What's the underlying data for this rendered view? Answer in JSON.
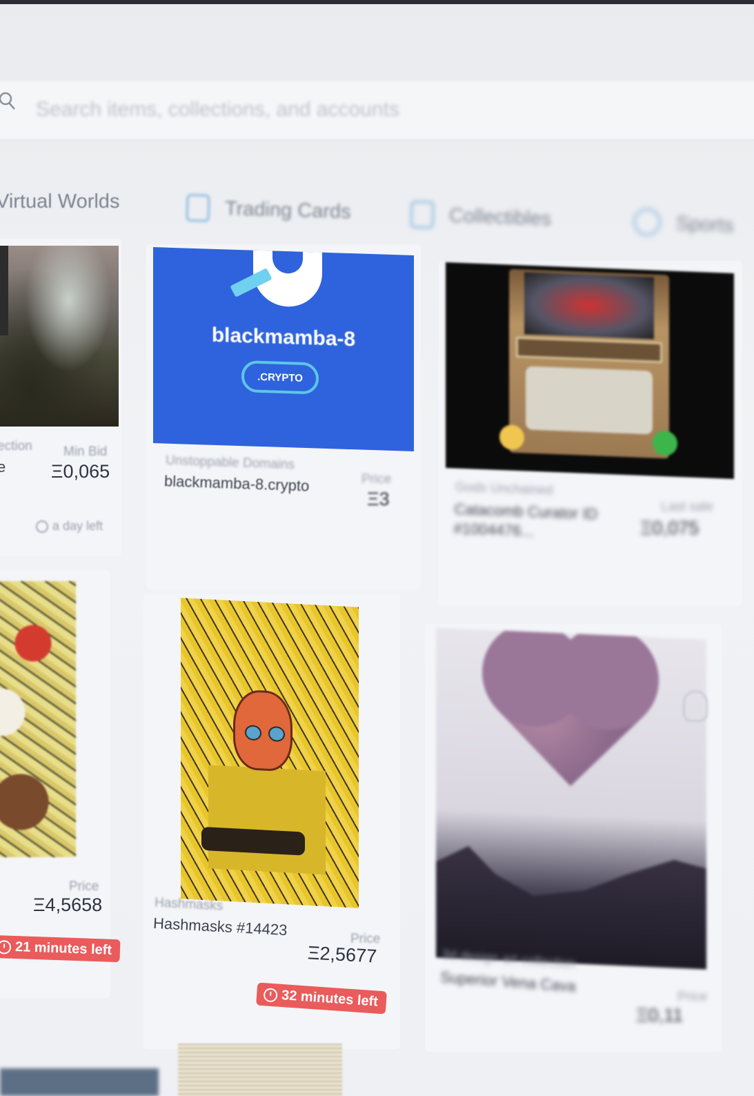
{
  "search": {
    "placeholder": "Search items, collections, and accounts"
  },
  "categories": [
    {
      "label": "Virtual Worlds",
      "icon": "globe-icon"
    },
    {
      "label": "Trading Cards",
      "icon": "cards-icon"
    },
    {
      "label": "Collectibles",
      "icon": "collectibles-icon"
    },
    {
      "label": "Sports",
      "icon": "sports-icon"
    }
  ],
  "cards": [
    {
      "collection": "ection",
      "name": "e",
      "price_label": "Min Bid",
      "price": "Ξ0,065",
      "time": "a day left"
    },
    {
      "artwork_title": "blackmamba-8",
      "artwork_badge": ".CRYPTO",
      "collection": "Unstoppable Domains",
      "name": "blackmamba-8.crypto",
      "price_label": "Price",
      "price": "Ξ3"
    },
    {
      "collection": "Gods Unchained",
      "name": "Catacomb Curator ID #1004476... ",
      "price_label": "Last sale",
      "price": "Ξ0,075"
    },
    {
      "price_label": "Price",
      "price": "Ξ4,5658",
      "time": "21 minutes left"
    },
    {
      "collection": "Hashmasks",
      "name": "Hashmasks #14423",
      "price_label": "Price",
      "price": "Ξ2,5677",
      "time": "32 minutes left"
    },
    {
      "collection": "3d design art collection",
      "name": "Superior Vena Cava",
      "price_label": "Price",
      "price": "Ξ0,11"
    }
  ],
  "colors": {
    "badge": "#ea5b5b",
    "tile_blue": "#2f63dd",
    "tile_cyan": "#5cc6e8"
  }
}
